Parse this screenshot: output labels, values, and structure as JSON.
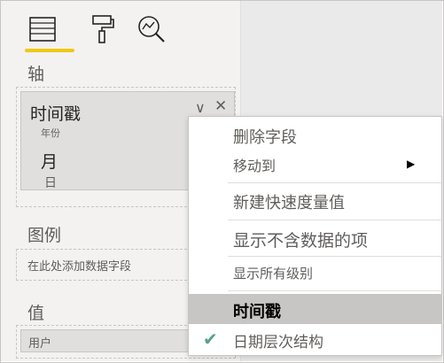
{
  "pane": {
    "tabs": [
      {
        "name": "fields-tab",
        "icon": "fields-icon",
        "active": true
      },
      {
        "name": "format-tab",
        "icon": "paint-roller-icon",
        "active": false
      },
      {
        "name": "analytics-tab",
        "icon": "analytics-icon",
        "active": false
      }
    ],
    "accent_color": "#f2c811",
    "axis": {
      "label": "轴",
      "field": {
        "name": "时间戳",
        "hierarchy": [
          "年份",
          "月",
          "日"
        ]
      }
    },
    "legend": {
      "label": "图例",
      "placeholder": "在此处添加数据字段"
    },
    "values": {
      "label": "值",
      "field": "用户"
    }
  },
  "context_menu": {
    "items": [
      {
        "label": "删除字段"
      },
      {
        "label": "移动到",
        "has_submenu": true
      },
      {
        "label": "新建快速度量值"
      },
      {
        "label": "显示不含数据的项"
      },
      {
        "label": "显示所有级别"
      },
      {
        "label": "时间戳",
        "selected": true
      },
      {
        "label": "日期层次结构",
        "checked": true
      }
    ],
    "check_color": "#55a08c"
  }
}
